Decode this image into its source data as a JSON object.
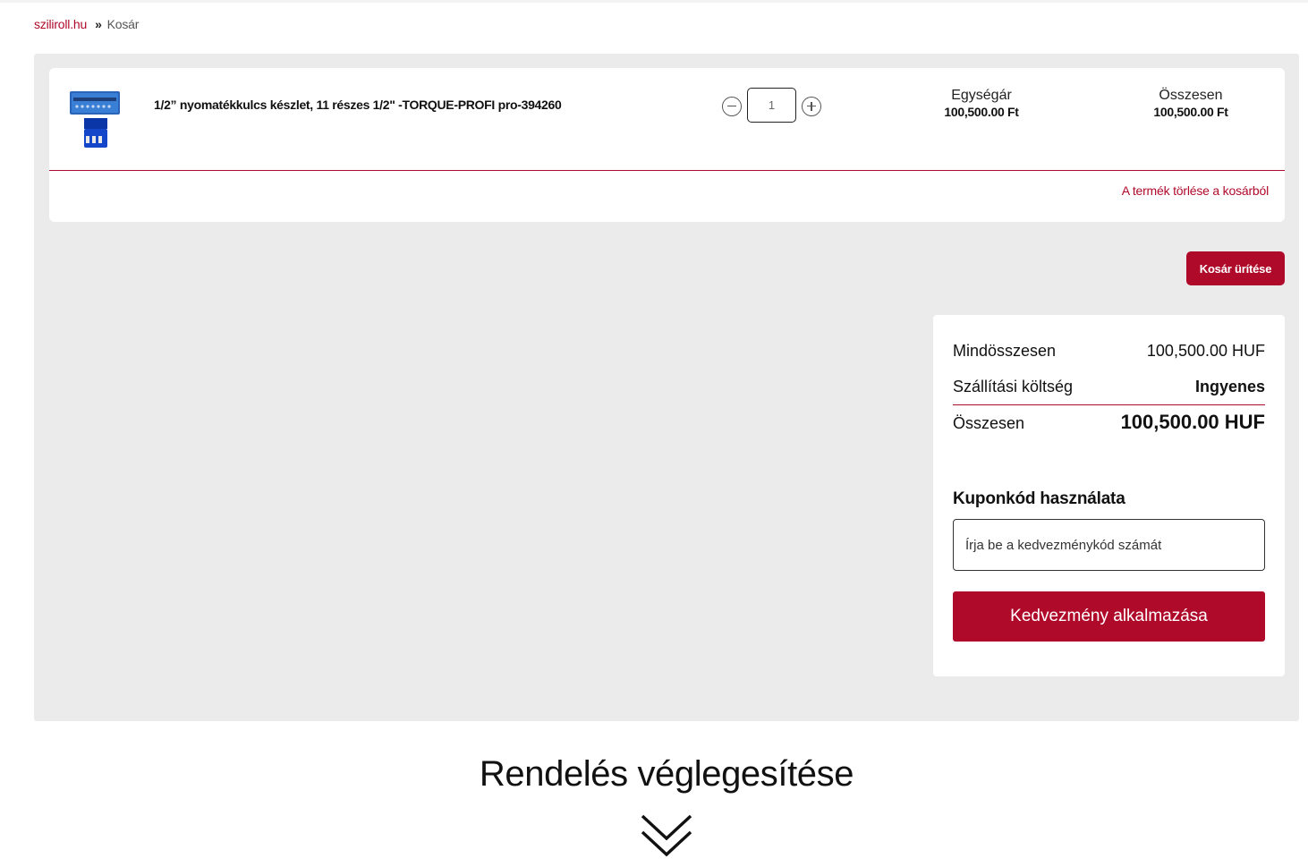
{
  "breadcrumb": {
    "home": "sziliroll.hu",
    "separator": "»",
    "current": "Kosár"
  },
  "cart": {
    "item": {
      "name": "1/2” nyomatékkulcs készlet, 11 részes 1/2\" -TORQUE-PROFI pro-394260",
      "quantity": "1",
      "unit_price_label": "Egységár",
      "unit_price": "100,500.00 Ft",
      "total_label": "Összesen",
      "total": "100,500.00 Ft",
      "remove_label": "A termék törlése a kosárból"
    },
    "empty_cart_label": "Kosár ürítése"
  },
  "summary": {
    "subtotal_label": "Mindösszesen",
    "subtotal_value": "100,500.00 HUF",
    "shipping_label": "Szállítási költség",
    "shipping_value": "Ingyenes",
    "total_label": "Összesen",
    "total_value": "100,500.00 HUF"
  },
  "coupon": {
    "title": "Kuponkód használata",
    "placeholder": "Írja be a kedvezménykód számát",
    "apply_label": "Kedvezmény alkalmazása"
  },
  "checkout": {
    "title": "Rendelés véglegesítése"
  },
  "colors": {
    "accent": "#b00a2b",
    "panel_bg": "#ebebeb"
  },
  "icons": {
    "minus": "minus-circle-icon",
    "plus": "plus-circle-icon",
    "scroll_down": "double-chevron-down-icon",
    "product": "toolcase-thumbnail"
  }
}
